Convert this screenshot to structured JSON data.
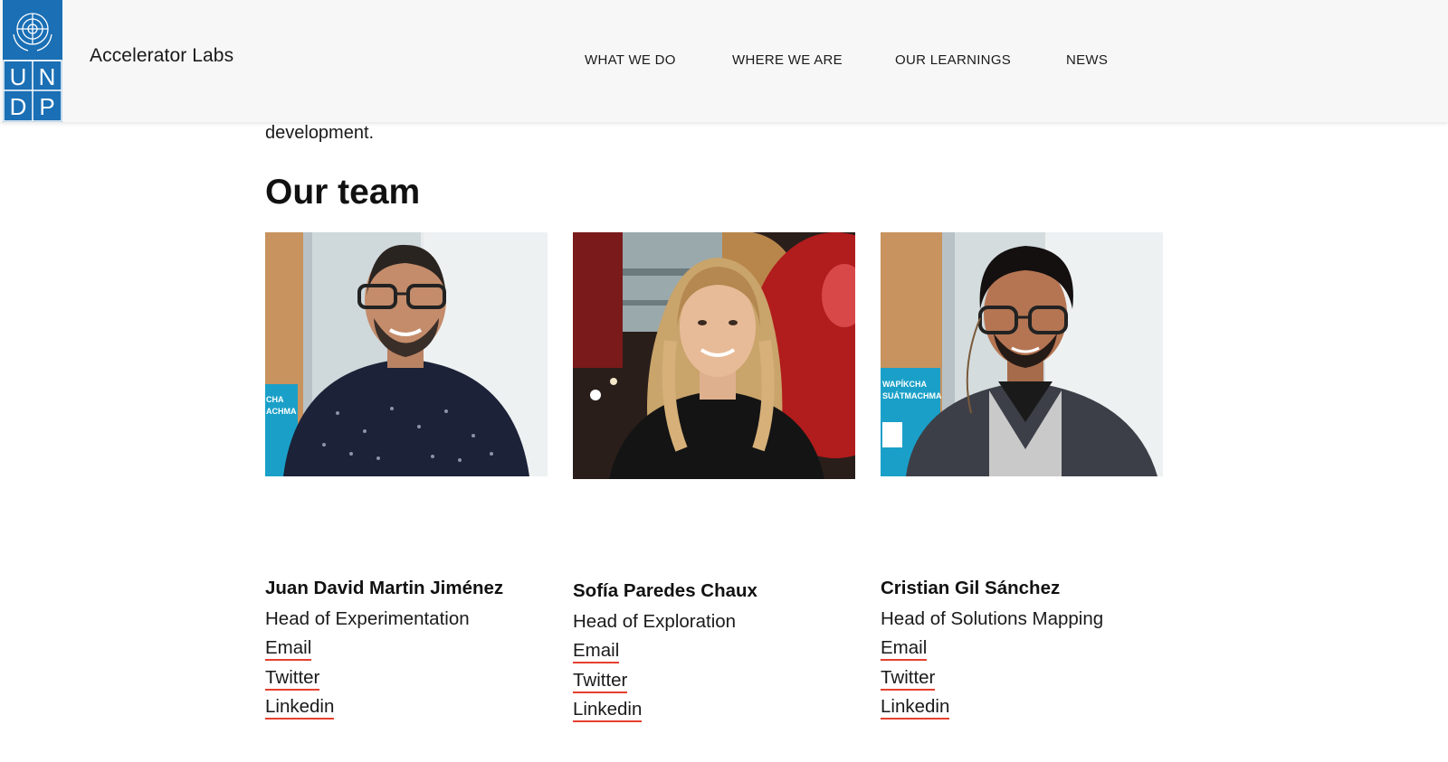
{
  "header": {
    "logo_letters": [
      "U",
      "N",
      "D",
      "P"
    ],
    "site_title": "Accelerator Labs",
    "nav": [
      {
        "label": "WHAT WE DO"
      },
      {
        "label": "WHERE WE ARE"
      },
      {
        "label": "OUR LEARNINGS"
      },
      {
        "label": "NEWS"
      }
    ]
  },
  "main": {
    "intro_tail": "development.",
    "section_title": "Our team",
    "team": [
      {
        "name": "Juan David Martin Jiménez",
        "role": "Head of Experimentation",
        "links": {
          "email": "Email",
          "twitter": "Twitter",
          "linkedin": "Linkedin"
        },
        "poster_text": [
          "CHA",
          "ACHMA"
        ]
      },
      {
        "name": "Sofía Paredes Chaux",
        "role": "Head of Exploration",
        "links": {
          "email": "Email",
          "twitter": "Twitter",
          "linkedin": "Linkedin"
        }
      },
      {
        "name": "Cristian Gil Sánchez",
        "role": "Head of Solutions Mapping",
        "links": {
          "email": "Email",
          "twitter": "Twitter",
          "linkedin": "Linkedin"
        },
        "poster_text": [
          "WAPÍKCHA",
          "SUÁTMACHMA"
        ]
      }
    ]
  },
  "colors": {
    "brand_blue": "#1a6fb5",
    "link_underline": "#e5402e",
    "header_bg": "#f7f7f7"
  }
}
